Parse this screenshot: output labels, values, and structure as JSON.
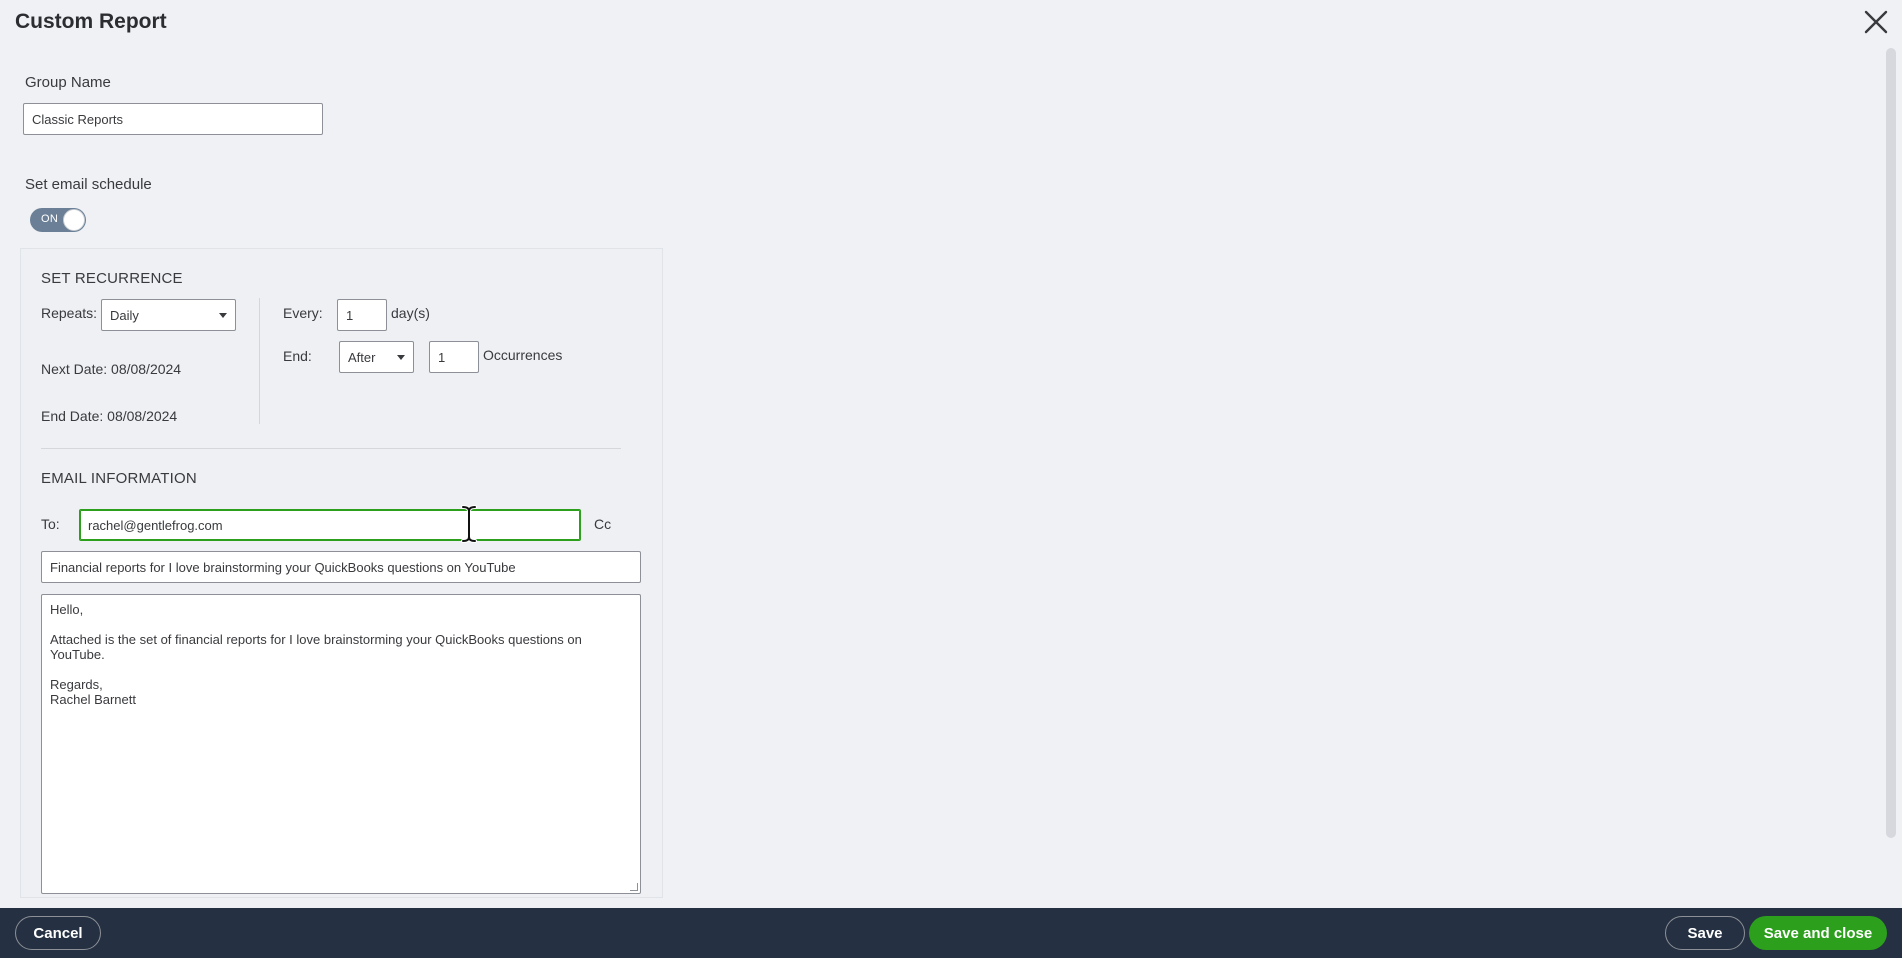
{
  "header": {
    "title": "Custom Report"
  },
  "group": {
    "label": "Group Name",
    "value": "Classic Reports"
  },
  "schedule": {
    "label": "Set email schedule",
    "toggle_text": "ON",
    "enabled": true
  },
  "recurrence": {
    "title": "SET RECURRENCE",
    "repeats_label": "Repeats:",
    "repeats_value": "Daily",
    "every_label": "Every:",
    "every_value": "1",
    "every_unit": "day(s)",
    "end_label": "End:",
    "end_value": "After",
    "occurrences_value": "1",
    "occurrences_label": "Occurrences",
    "next_date": "Next Date: 08/08/2024",
    "end_date": "End Date: 08/08/2024"
  },
  "email": {
    "title": "EMAIL INFORMATION",
    "to_label": "To:",
    "to_value": "rachel@gentlefrog.com",
    "cc_label": "Cc",
    "subject": "Financial reports for I love brainstorming your QuickBooks questions on YouTube",
    "body_lines": [
      "Hello,",
      "",
      "Attached is the set of financial reports for I love brainstorming your QuickBooks questions on",
      "YouTube.",
      "",
      "Regards,",
      "Rachel Barnett"
    ]
  },
  "footer": {
    "cancel_label": "Cancel",
    "save_label": "Save",
    "save_close_label": "Save and close"
  },
  "colors": {
    "accent_green": "#2ca01c",
    "footer_bg": "#253143",
    "toggle_on": "#6b8096"
  },
  "icons": [
    "close-icon",
    "dropdown-caret-icon",
    "text-cursor-icon"
  ]
}
